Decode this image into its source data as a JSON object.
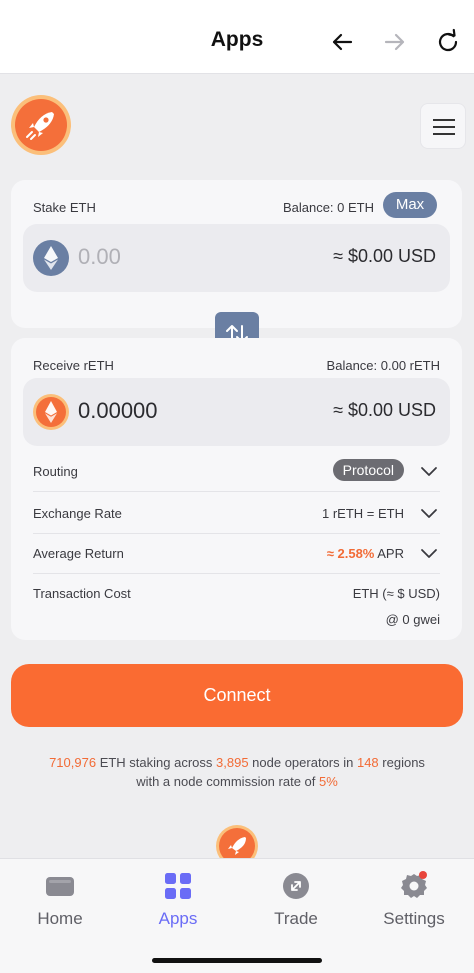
{
  "topbar": {
    "title": "Apps"
  },
  "stake": {
    "label": "Stake ETH",
    "balance": "Balance: 0 ETH",
    "max_label": "Max",
    "amount": "0.00",
    "usd": "≈  $0.00 USD"
  },
  "receive": {
    "label": "Receive rETH",
    "balance": "Balance: 0.00 rETH",
    "amount": "0.00000",
    "usd": "≈  $0.00 USD"
  },
  "details": {
    "routing_label": "Routing",
    "routing_value": "Protocol",
    "exchange_label": "Exchange Rate",
    "exchange_value": "1 rETH = ETH",
    "return_label": "Average Return",
    "return_value": "≈ 2.58%",
    "return_unit": "APR",
    "cost_label": "Transaction Cost",
    "cost_value": "ETH (≈ $ USD)",
    "gas_value": "@ 0 gwei"
  },
  "connect_label": "Connect",
  "stats": {
    "eth_staked": "710,976",
    "text1": " ETH staking across ",
    "operators": "3,895",
    "text2": " node operators in ",
    "regions": "148",
    "text3": " regions",
    "text4": "with a node commission rate of ",
    "commission": "5%"
  },
  "tabs": [
    {
      "label": "Home"
    },
    {
      "label": "Apps"
    },
    {
      "label": "Trade"
    },
    {
      "label": "Settings"
    }
  ],
  "colors": {
    "accent_orange": "#fa6b32",
    "accent_blue": "#6a7fa3",
    "active_tab": "#6a6cf6"
  }
}
